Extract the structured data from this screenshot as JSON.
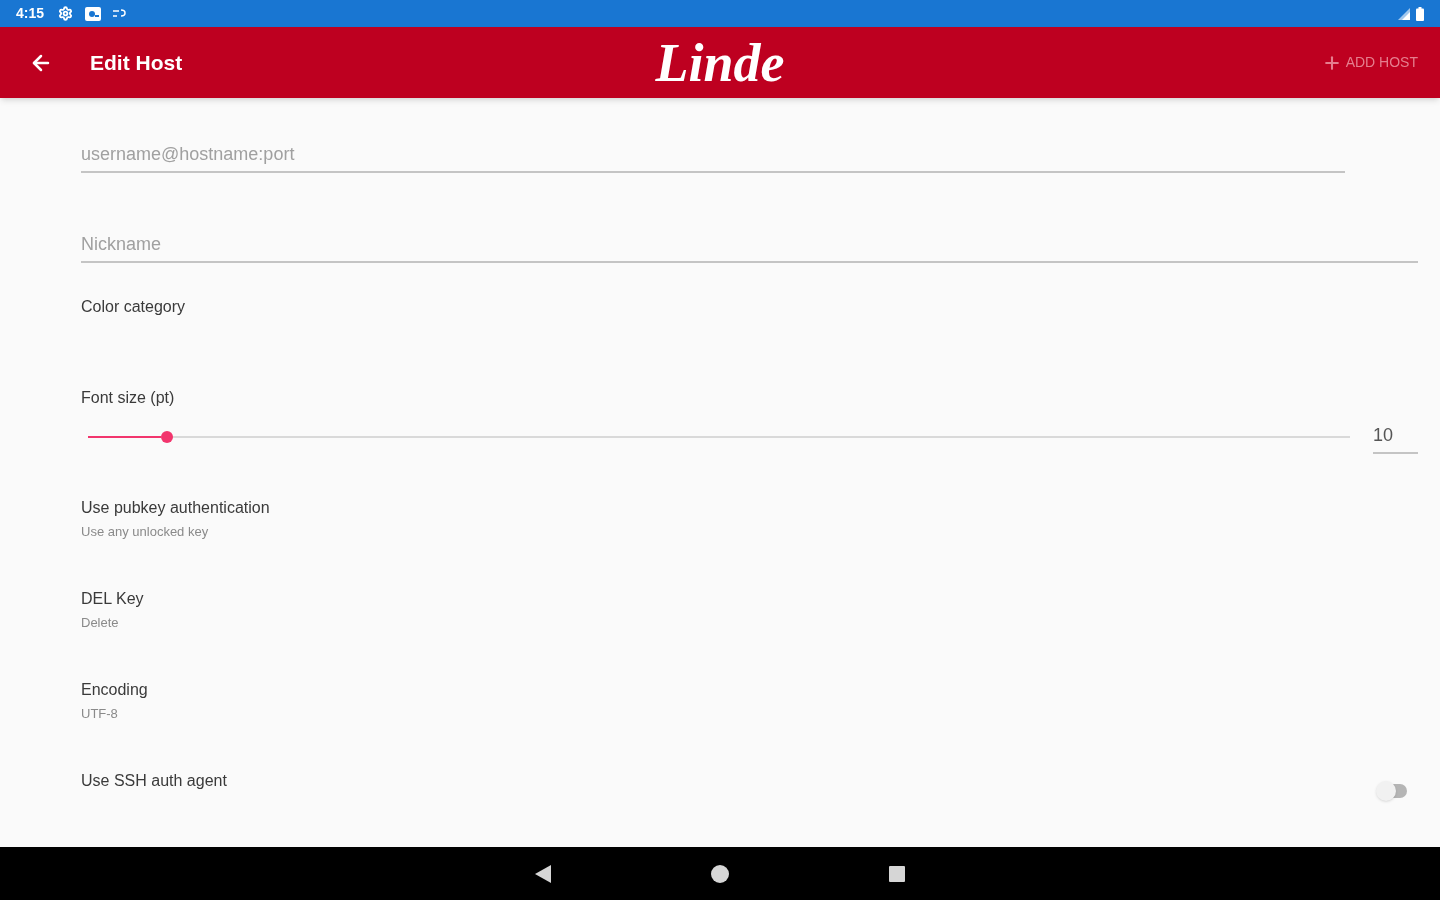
{
  "status_bar": {
    "time": "4:15"
  },
  "app_bar": {
    "title": "Edit Host",
    "logo": "Linde",
    "action": {
      "label": "ADD HOST",
      "disabled": true
    }
  },
  "fields": [
    {
      "placeholder": "username@hostname:port"
    },
    {
      "placeholder": "Nickname"
    }
  ],
  "settings": [
    {
      "kind": "label",
      "title": "Color category"
    },
    {
      "kind": "slider",
      "title": "Font size (pt)",
      "level": 0.0625,
      "value": "10"
    },
    {
      "kind": "summary",
      "title": "Use pubkey authentication",
      "summary": "Use any unlocked key"
    },
    {
      "kind": "summary",
      "title": "DEL Key",
      "summary": "Delete"
    },
    {
      "kind": "summary",
      "title": "Encoding",
      "summary": "UTF-8"
    },
    {
      "kind": "switch",
      "title": "Use SSH auth agent",
      "on": false
    }
  ]
}
